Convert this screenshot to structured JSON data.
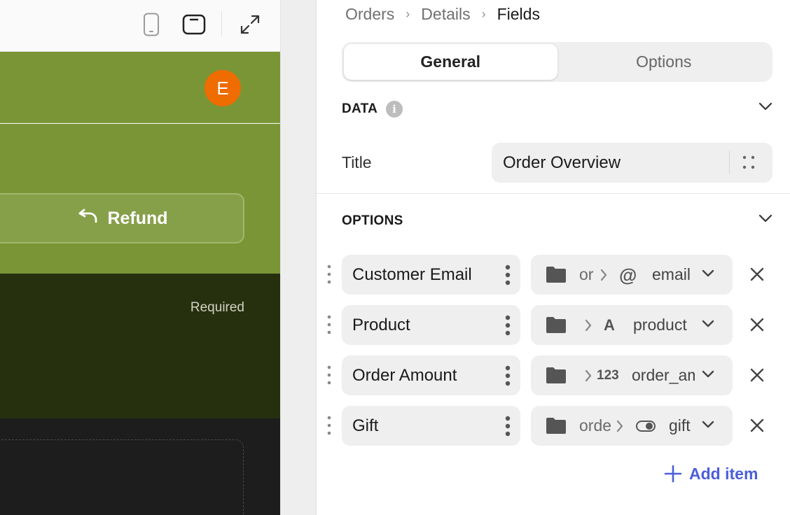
{
  "preview": {
    "toolbar": {
      "icons": [
        "phone-icon",
        "tablet-icon",
        "expand-icon"
      ]
    },
    "avatar_letter": "E",
    "refund_label": "Refund",
    "required_label": "Required",
    "colors": {
      "header": "#7a9536",
      "dark": "#26300f",
      "black": "#1d1d1d",
      "avatar": "#ef6c00"
    }
  },
  "panel": {
    "breadcrumb": [
      "Orders",
      "Details",
      "Fields"
    ],
    "tabs": [
      {
        "label": "General",
        "active": true
      },
      {
        "label": "Options",
        "active": false
      }
    ],
    "data_section": {
      "title": "DATA",
      "title_label": "Title",
      "title_value": "Order Overview"
    },
    "options_section": {
      "title": "OPTIONS",
      "rows": [
        {
          "label": "Customer Email",
          "path_prefix": "or",
          "type_icon": "at-icon",
          "type_glyph": "@",
          "field": "email"
        },
        {
          "label": "Product",
          "path_prefix": "",
          "type_icon": "text-type-icon",
          "type_glyph": "A",
          "field": "product"
        },
        {
          "label": "Order Amount",
          "path_prefix": "",
          "type_icon": "number-type-icon",
          "type_glyph": "123",
          "field": "order_amount"
        },
        {
          "label": "Gift",
          "path_prefix": "orde",
          "type_icon": "toggle-type-icon",
          "type_glyph": "",
          "field": "gift"
        }
      ],
      "add_label": "Add item"
    },
    "accent_color": "#4b5fd9"
  }
}
